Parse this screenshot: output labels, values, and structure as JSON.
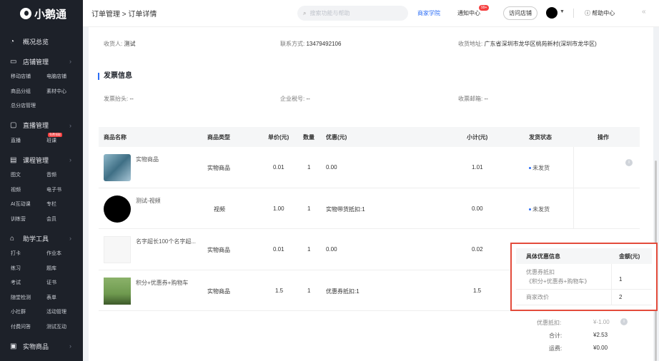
{
  "sidebar": {
    "logo": "小鹅通",
    "overview": "概况总览",
    "groups": [
      {
        "title": "店铺管理",
        "items": [
          "移动店铺",
          "电脑店铺",
          "商品分组",
          "素材中心",
          "总分店管理"
        ]
      },
      {
        "title": "直播管理",
        "items": [
          "直播",
          "班课"
        ],
        "badge": "免费领取"
      },
      {
        "title": "课程管理",
        "items": [
          "图文",
          "音频",
          "视频",
          "电子书",
          "AI互动课",
          "专栏",
          "训练营",
          "会员"
        ]
      },
      {
        "title": "助学工具",
        "items": [
          "打卡",
          "作业本",
          "练习",
          "题库",
          "考试",
          "证书",
          "随堂检测",
          "表单",
          "小社群",
          "活动管理",
          "付费问答",
          "测试互动"
        ]
      },
      {
        "title": "实物商品",
        "items": []
      }
    ]
  },
  "topbar": {
    "breadcrumb": "订单管理 > 订单详情",
    "search_placeholder": "搜索功能与帮助",
    "academy": "商家学院",
    "notify": "通知中心",
    "notify_badge": "99+",
    "visit_store": "访问店铺",
    "help": "帮助中心"
  },
  "receiver": {
    "name_label": "收货人:",
    "name": "测试",
    "phone_label": "联系方式:",
    "phone": "13479492106",
    "addr_label": "收货地址:",
    "addr": "广东省深圳市龙华区桃苑新村(深圳市龙华区)"
  },
  "invoice": {
    "title": "发票信息",
    "header_label": "发票抬头:",
    "header": "--",
    "tax_label": "企业税号:",
    "tax": "--",
    "email_label": "收票邮箱:",
    "email": "--"
  },
  "table": {
    "columns": [
      "商品名称",
      "商品类型",
      "单价(元)",
      "数量",
      "优惠(元)",
      "小计(元)",
      "发货状态",
      "操作"
    ],
    "rows": [
      {
        "name": "实物商品",
        "type": "实物商品",
        "price": "0.01",
        "qty": "1",
        "discount": "0.00",
        "subtotal": "1.01",
        "status": "未发货"
      },
      {
        "name": "测试-视频",
        "type": "视频",
        "price": "1.00",
        "qty": "1",
        "discount": "实物带货抵扣:1",
        "subtotal": "0.00",
        "status": "未发货"
      },
      {
        "name": "名字超长100个名字超...",
        "type": "实物商品",
        "price": "0.01",
        "qty": "1",
        "discount": "0.00",
        "subtotal": "0.02",
        "status": ""
      },
      {
        "name": "积分+优惠券+购物车",
        "type": "实物商品",
        "price": "1.5",
        "qty": "1",
        "discount": "优惠券抵扣:1",
        "subtotal": "1.5",
        "status": ""
      }
    ]
  },
  "popover": {
    "col1": "具体优惠信息",
    "col2": "金额(元)",
    "rows": [
      {
        "label": "优惠券抵扣",
        "sub": "《积分+优惠券+购物车》",
        "amount": "1"
      },
      {
        "label": "商家改价",
        "sub": "",
        "amount": "2"
      }
    ]
  },
  "summary": {
    "discount_label": "优惠抵扣:",
    "discount": "¥-1.00",
    "total_label": "合计:",
    "total": "¥2.53",
    "freight_label": "运费:",
    "freight": "¥0.00"
  }
}
